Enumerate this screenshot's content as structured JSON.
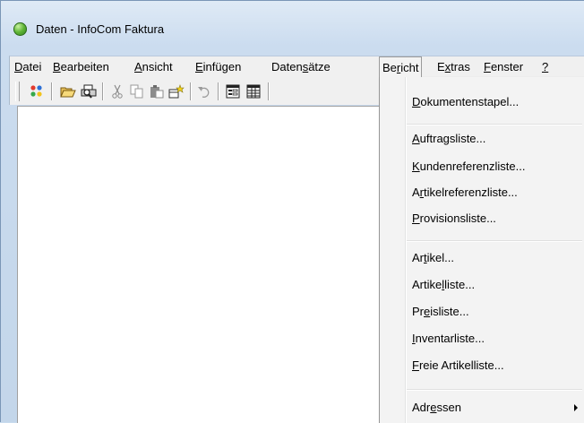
{
  "window": {
    "title": "Daten - InfoCom Faktura"
  },
  "menubar": {
    "items": [
      {
        "pre": "",
        "acc": "D",
        "post": "atei"
      },
      {
        "pre": "",
        "acc": "B",
        "post": "earbeiten"
      },
      {
        "pre": "",
        "acc": "A",
        "post": "nsicht"
      },
      {
        "pre": "",
        "acc": "E",
        "post": "infügen"
      },
      {
        "pre": "Daten",
        "acc": "s",
        "post": "ätze"
      },
      {
        "pre": "Be",
        "acc": "r",
        "post": "icht"
      },
      {
        "pre": "E",
        "acc": "x",
        "post": "tras"
      },
      {
        "pre": "",
        "acc": "F",
        "post": "enster"
      },
      {
        "pre": "",
        "acc": "?",
        "post": ""
      }
    ]
  },
  "toolbar": {
    "icons": [
      "colorful-dots-icon",
      "open-folder-icon",
      "print-preview-icon",
      "cut-icon",
      "copy-icon",
      "paste-icon",
      "paste-special-icon",
      "undo-icon",
      "form-view-icon",
      "table-view-icon"
    ]
  },
  "bericht_menu": {
    "items": [
      {
        "pre": "",
        "acc": "D",
        "post": "okumentenstapel..."
      },
      {
        "pre": "",
        "acc": "A",
        "post": "uftragsliste..."
      },
      {
        "pre": "",
        "acc": "K",
        "post": "undenreferenzliste..."
      },
      {
        "pre": "A",
        "acc": "r",
        "post": "tikelreferenzliste..."
      },
      {
        "pre": "",
        "acc": "P",
        "post": "rovisionsliste..."
      },
      {
        "pre": "Ar",
        "acc": "t",
        "post": "ikel..."
      },
      {
        "pre": "Artike",
        "acc": "l",
        "post": "liste..."
      },
      {
        "pre": "Pr",
        "acc": "e",
        "post": "isliste..."
      },
      {
        "pre": "",
        "acc": "I",
        "post": "nventarliste..."
      },
      {
        "pre": "",
        "acc": "F",
        "post": "reie Artikelliste..."
      },
      {
        "pre": "Adr",
        "acc": "e",
        "post": "ssen"
      }
    ]
  }
}
